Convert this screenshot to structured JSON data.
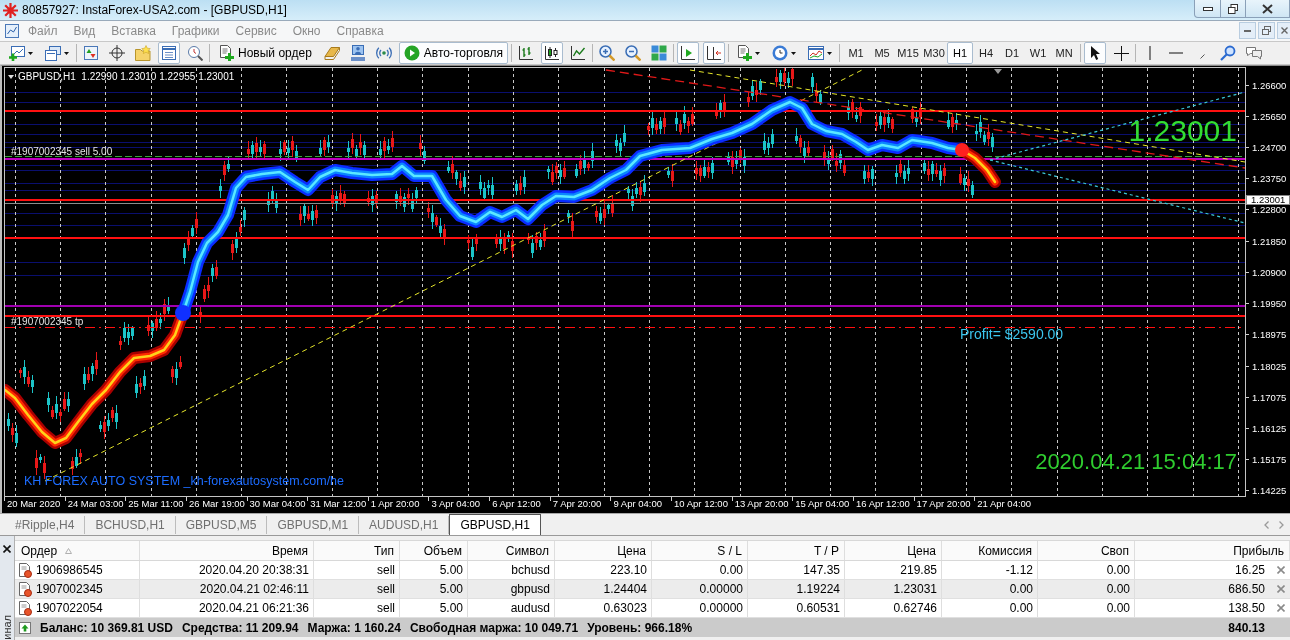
{
  "window": {
    "title": "80857927: InstaForex-USA2.com - [GBPUSD,H1]"
  },
  "menu": [
    "Файл",
    "Вид",
    "Вставка",
    "Графики",
    "Сервис",
    "Окно",
    "Справка"
  ],
  "toolbar": {
    "left": [
      [
        {
          "kind": "new-chart",
          "pressed": false
        },
        {
          "kind": "profiles",
          "pressed": false
        }
      ],
      [
        {
          "kind": "market-watch",
          "pressed": false
        },
        {
          "kind": "data-window",
          "pressed": false
        },
        {
          "kind": "navigator",
          "pressed": false
        },
        {
          "kind": "terminal",
          "pressed": true
        },
        {
          "kind": "tester",
          "pressed": false
        }
      ],
      [
        {
          "kind": "new-order",
          "label": "Новый ордер",
          "pressed": false
        },
        {
          "kind": "editor",
          "pressed": false
        },
        {
          "kind": "signals",
          "pressed": false
        },
        {
          "kind": "radio",
          "pressed": false
        },
        {
          "kind": "auto-trading",
          "label": "Авто-торговля",
          "pressed": true
        }
      ],
      [
        {
          "kind": "bars",
          "pressed": false
        },
        {
          "kind": "candles",
          "pressed": true
        },
        {
          "kind": "line",
          "pressed": false
        }
      ],
      [
        {
          "kind": "zoom-in",
          "pressed": false
        },
        {
          "kind": "zoom-out",
          "pressed": false
        },
        {
          "kind": "tile",
          "pressed": false
        }
      ],
      [
        {
          "kind": "autoscroll",
          "pressed": true
        },
        {
          "kind": "chart-shift",
          "pressed": true
        }
      ],
      [
        {
          "kind": "indicators",
          "pressed": false
        },
        {
          "kind": "periods",
          "pressed": false
        },
        {
          "kind": "templates",
          "pressed": false
        }
      ]
    ],
    "periods": [
      {
        "label": "M1",
        "selected": false
      },
      {
        "label": "M5",
        "selected": false
      },
      {
        "label": "M15",
        "selected": false
      },
      {
        "label": "M30",
        "selected": false
      },
      {
        "label": "H1",
        "selected": true
      },
      {
        "label": "H4",
        "selected": false
      },
      {
        "label": "D1",
        "selected": false
      },
      {
        "label": "W1",
        "selected": false
      },
      {
        "label": "MN",
        "selected": false
      }
    ],
    "right": [
      [
        {
          "kind": "cursor",
          "pressed": true
        },
        {
          "kind": "crosshair",
          "pressed": false
        }
      ],
      [
        {
          "kind": "vline",
          "pressed": false
        },
        {
          "kind": "hline",
          "pressed": false
        },
        {
          "kind": "trendline",
          "pressed": false
        },
        {
          "kind": "magnifier",
          "pressed": false
        },
        {
          "kind": "text",
          "pressed": false
        }
      ]
    ]
  },
  "chart": {
    "symbol": "GBPUSD,H1",
    "quotes": [
      "1.22990",
      "1.23010",
      "1.22955",
      "1.23001"
    ],
    "order_labels": [
      "#1907002345 sell 5.00",
      "#1907002345 tp"
    ],
    "last_price": "1.23001",
    "profit": "Profit= $2590.00",
    "system_label": "KH FOREX AUTO SYSTEM _kh-forexautosystem.com/he",
    "server_time": "2020.04.21 15:04:17",
    "price_axis": [
      "1.26600",
      "1.25650",
      "1.24700",
      "1.23750",
      "1.22800",
      "1.21850",
      "1.20900",
      "1.19950",
      "1.18975",
      "1.18025",
      "1.17075",
      "1.16125",
      "1.15175",
      "1.14225"
    ],
    "current_price": "1.23001",
    "time_axis": [
      "20 Mar 2020",
      "24 Mar 03:00",
      "25 Mar 11:00",
      "26 Mar 19:00",
      "30 Mar 04:00",
      "31 Mar 12:00",
      "1 Apr 20:00",
      "3 Apr 04:00",
      "6 Apr 12:00",
      "7 Apr 20:00",
      "9 Apr 04:00",
      "10 Apr 12:00",
      "13 Apr 20:00",
      "15 Apr 04:00",
      "16 Apr 12:00",
      "17 Apr 20:00",
      "21 Apr 04:00"
    ]
  },
  "tabs": [
    {
      "label": "#Ripple,H4",
      "selected": false
    },
    {
      "label": "BCHUSD,H1",
      "selected": false
    },
    {
      "label": "GBPUSD,M5",
      "selected": false
    },
    {
      "label": "GBPUSD,M1",
      "selected": false
    },
    {
      "label": "AUDUSD,H1",
      "selected": false
    },
    {
      "label": "GBPUSD,H1",
      "selected": true
    }
  ],
  "terminal": {
    "side_label": "инал",
    "columns": [
      "Ордер",
      "Время",
      "Тип",
      "Объем",
      "Символ",
      "Цена",
      "S / L",
      "T / P",
      "Цена",
      "Комиссия",
      "Своп",
      "Прибыль"
    ],
    "rows": [
      {
        "cells": [
          "1906986545",
          "2020.04.20 20:38:31",
          "sell",
          "5.00",
          "bchusd",
          "223.10",
          "0.00",
          "147.35",
          "219.85",
          "-1.12",
          "0.00",
          "16.25"
        ]
      },
      {
        "cells": [
          "1907002345",
          "2020.04.21 02:46:11",
          "sell",
          "5.00",
          "gbpusd",
          "1.24404",
          "0.00000",
          "1.19224",
          "1.23031",
          "0.00",
          "0.00",
          "686.50"
        ]
      },
      {
        "cells": [
          "1907022054",
          "2020.04.21 06:21:36",
          "sell",
          "5.00",
          "audusd",
          "0.63023",
          "0.00000",
          "0.60531",
          "0.62746",
          "0.00",
          "0.00",
          "138.50"
        ]
      }
    ],
    "summary": [
      "Баланс: 10 369.81 USD",
      "Средства: 11 209.94",
      "Маржа: 1 160.24",
      "Свободная маржа: 10 049.71",
      "Уровень: 966.18%"
    ],
    "total": "840.13"
  }
}
